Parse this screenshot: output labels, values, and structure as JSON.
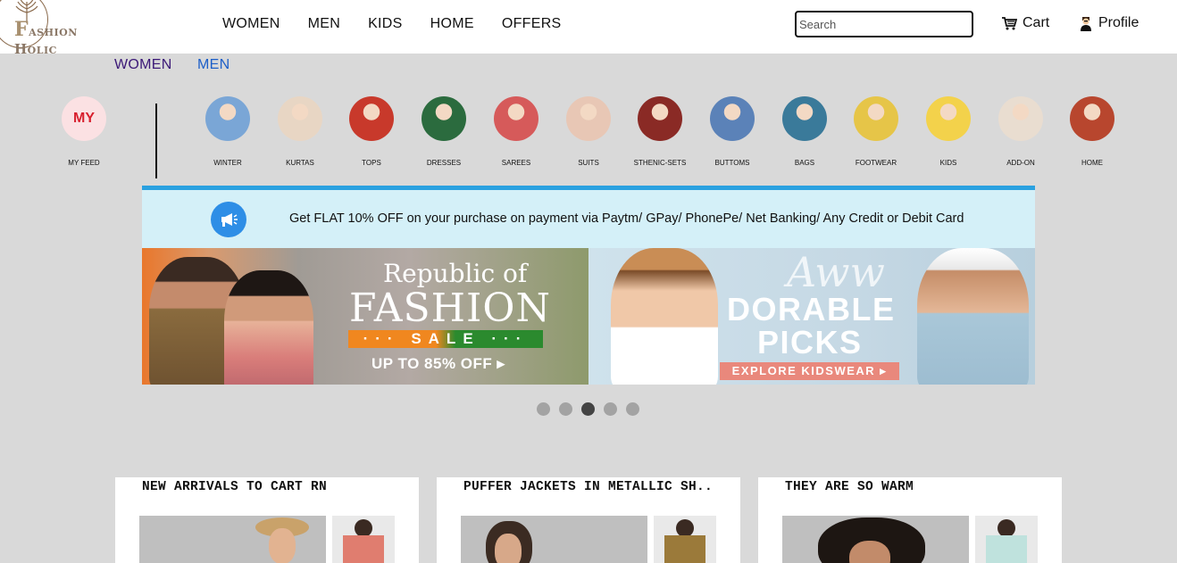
{
  "brand": {
    "logo_initial": "F",
    "logo_rest": "ashion Holic"
  },
  "nav": {
    "items": [
      "WOMEN",
      "MEN",
      "KIDS",
      "HOME",
      "OFFERS"
    ]
  },
  "search": {
    "placeholder": "Search"
  },
  "cart": {
    "label": "Cart",
    "icon": "cart-icon"
  },
  "profile": {
    "label": "Profile",
    "icon": "user-icon"
  },
  "gender_tabs": {
    "women": "WOMEN",
    "men": "MEN"
  },
  "my_feed": {
    "badge": "MY",
    "label": "MY FEED"
  },
  "categories": [
    {
      "label": "WINTER",
      "color": "#7aa6d6"
    },
    {
      "label": "KURTAS",
      "color": "#e8d6c4"
    },
    {
      "label": "TOPS",
      "color": "#c8392b"
    },
    {
      "label": "DRESSES",
      "color": "#2b6b3e"
    },
    {
      "label": "SAREES",
      "color": "#d65a5a"
    },
    {
      "label": "SUITS",
      "color": "#e8c7b5"
    },
    {
      "label": "STHENIC-SETS",
      "color": "#8a2a25"
    },
    {
      "label": "BUTTOMS",
      "color": "#5b82b8"
    },
    {
      "label": "BAGS",
      "color": "#3a7a9a"
    },
    {
      "label": "FOOTWEAR",
      "color": "#e6c548"
    },
    {
      "label": "KIDS",
      "color": "#f3d24b"
    },
    {
      "label": "ADD-ON",
      "color": "#e9ddd0"
    },
    {
      "label": "HOME",
      "color": "#b8462e"
    }
  ],
  "offer": {
    "text": "Get FLAT 10% OFF on your purchase on payment via Paytm/ GPay/ PhonePe/ Net Banking/ Any Credit or Debit Card",
    "icon": "megaphone-icon"
  },
  "banners": {
    "left": {
      "line1": "Republic of",
      "line2": "FASHION",
      "sale": "··· SALE ···",
      "offer": "UP TO 85% OFF ▸"
    },
    "right": {
      "script": "Aww",
      "line1": "DORABLE",
      "line2": "PICKS",
      "cta": "EXPLORE KIDSWEAR ▸"
    }
  },
  "carousel": {
    "total": 5,
    "active_index": 2
  },
  "cards": [
    {
      "title": "NEW ARRIVALS TO CART RN"
    },
    {
      "title": "PUFFER JACKETS IN METALLIC SH.."
    },
    {
      "title": "THEY ARE SO WARM"
    }
  ]
}
